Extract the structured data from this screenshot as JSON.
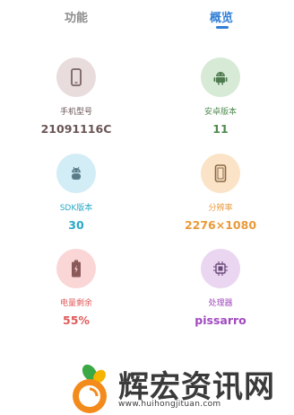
{
  "tabs": [
    {
      "label": "功能",
      "active": false
    },
    {
      "label": "概览",
      "active": true
    }
  ],
  "accent_color": "#2f7fd6",
  "items": [
    {
      "label": "手机型号",
      "value": "21091116C",
      "icon": "phone-icon",
      "circle_color": "#e8dcdc",
      "icon_color": "#7a6464",
      "text_color": "#6b5656"
    },
    {
      "label": "安卓版本",
      "value": "11",
      "icon": "android-icon",
      "circle_color": "#d6ead6",
      "icon_color": "#4f7a4f",
      "text_color": "#4f8a4f"
    },
    {
      "label": "SDK版本",
      "value": "30",
      "icon": "android-sdk-icon",
      "circle_color": "#d2edf6",
      "icon_color": "#5a7c8a",
      "text_color": "#2aa8c8"
    },
    {
      "label": "分辨率",
      "value": "2276×1080",
      "icon": "screen-icon",
      "circle_color": "#fbe3c8",
      "icon_color": "#8a6a44",
      "text_color": "#e89a3a"
    },
    {
      "label": "电量剩余",
      "value": "55%",
      "icon": "battery-icon",
      "circle_color": "#fad6d6",
      "icon_color": "#8a5a5a",
      "text_color": "#e05a5a"
    },
    {
      "label": "处理器",
      "value": "pissarro",
      "icon": "cpu-icon",
      "circle_color": "#ead6f0",
      "icon_color": "#6a4a7a",
      "text_color": "#a04ac0"
    }
  ],
  "watermark": {
    "title": "辉宏资讯网",
    "url": "www.huihongjituan.com"
  }
}
